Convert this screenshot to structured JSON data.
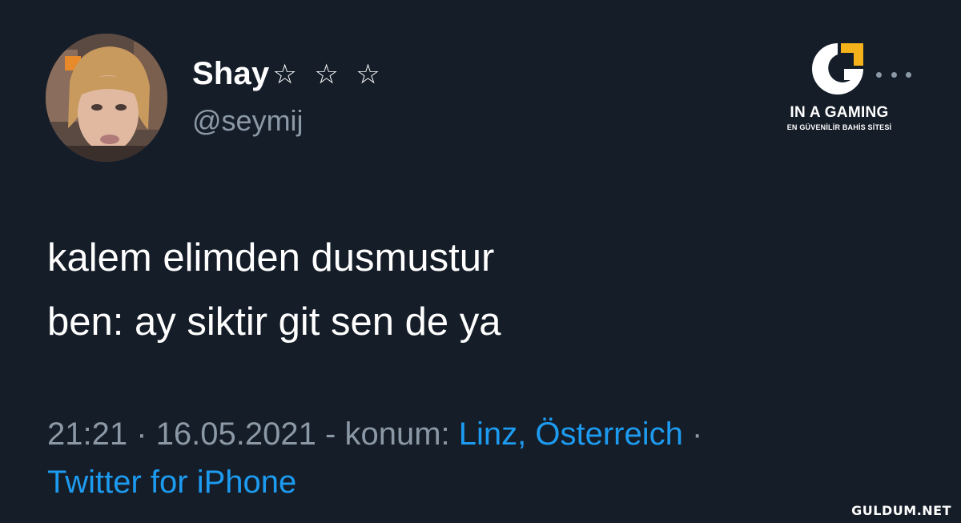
{
  "author": {
    "display_name": "Shay",
    "name_stars": "☆ ☆ ☆",
    "handle": "@seymij"
  },
  "brand": {
    "title": "IN A GAMING",
    "subtitle": "EN GÜVENİLİR BAHİS SİTESİ",
    "accent_color": "#f5b21a"
  },
  "tweet": {
    "lines": [
      "kalem elimden dusmustur",
      "ben: ay siktir git sen de ya"
    ]
  },
  "meta": {
    "time": "21:21",
    "separator_dot": "·",
    "date": "16.05.2021",
    "location_prefix": "- konum:",
    "location": "Linz, Österreich",
    "source": "Twitter for iPhone"
  },
  "watermark": "GULDUM.NET",
  "colors": {
    "background": "#151d28",
    "secondary_text": "#8b98a5",
    "link": "#1d9bf0"
  }
}
